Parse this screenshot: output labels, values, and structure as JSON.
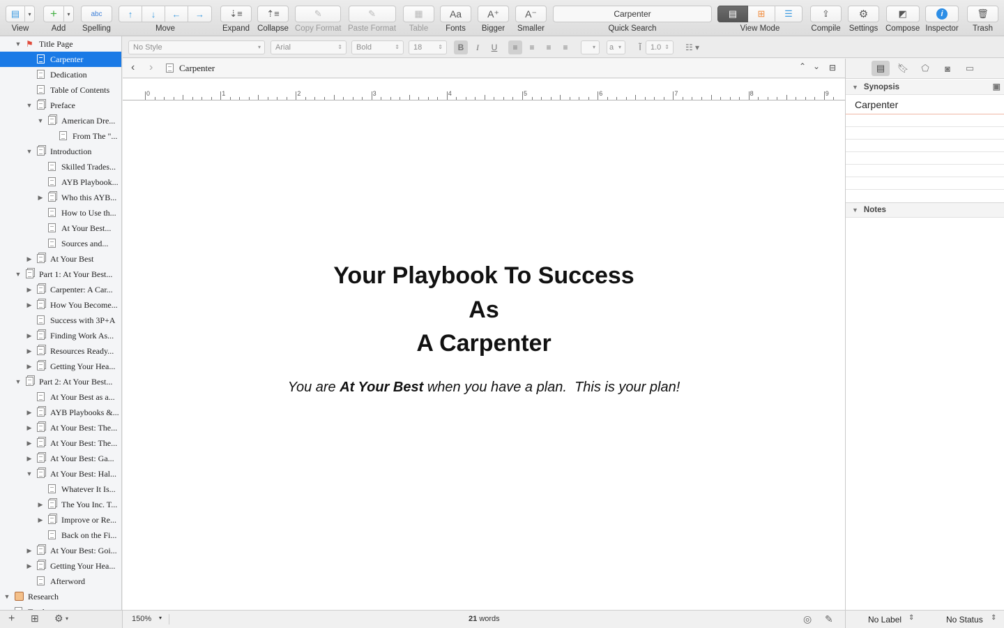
{
  "toolbar": {
    "view": "View",
    "add": "Add",
    "spelling": "Spelling",
    "move": "Move",
    "expand": "Expand",
    "collapse": "Collapse",
    "copy_format": "Copy Format",
    "paste_format": "Paste Format",
    "table": "Table",
    "fonts": "Fonts",
    "bigger": "Bigger",
    "smaller": "Smaller",
    "quick_search_value": "Carpenter",
    "quick_search": "Quick Search",
    "view_mode": "View Mode",
    "compile": "Compile",
    "settings": "Settings",
    "compose": "Compose",
    "inspector": "Inspector",
    "trash": "Trash",
    "spelling_icon_text": "abc",
    "fonts_icon_text": "Aa",
    "bigger_icon_text": "A⁺",
    "smaller_icon_text": "A⁻"
  },
  "binder": {
    "items": [
      {
        "label": "Title Page"
      },
      {
        "label": "Carpenter"
      },
      {
        "label": "Dedication"
      },
      {
        "label": "Table of Contents"
      },
      {
        "label": "Preface"
      },
      {
        "label": "American Dre..."
      },
      {
        "label": "From The \"..."
      },
      {
        "label": "Introduction"
      },
      {
        "label": "Skilled Trades..."
      },
      {
        "label": "AYB Playbook..."
      },
      {
        "label": "Who this AYB..."
      },
      {
        "label": "How to Use th..."
      },
      {
        "label": "At Your Best..."
      },
      {
        "label": "Sources and..."
      },
      {
        "label": "At Your Best"
      },
      {
        "label": "Part 1:  At Your Best..."
      },
      {
        "label": "Carpenter:  A Car..."
      },
      {
        "label": "How You Become..."
      },
      {
        "label": "Success with 3P+A"
      },
      {
        "label": "Finding Work As..."
      },
      {
        "label": "Resources Ready..."
      },
      {
        "label": "Getting Your Hea..."
      },
      {
        "label": "Part 2:  At Your Best..."
      },
      {
        "label": "At Your Best as a..."
      },
      {
        "label": "AYB Playbooks &..."
      },
      {
        "label": "At Your Best: The..."
      },
      {
        "label": "At Your Best: The..."
      },
      {
        "label": "At Your Best: Ga..."
      },
      {
        "label": "At Your Best: Hal..."
      },
      {
        "label": "Whatever It Is..."
      },
      {
        "label": "The You Inc. T..."
      },
      {
        "label": "Improve or Re..."
      },
      {
        "label": "Back on the Fi..."
      },
      {
        "label": "At Your Best: Goi..."
      },
      {
        "label": "Getting Your Hea..."
      },
      {
        "label": "Afterword"
      },
      {
        "label": "Research"
      },
      {
        "label": "Trash"
      }
    ]
  },
  "format": {
    "style": "No Style",
    "font": "Arial",
    "weight": "Bold",
    "size": "18",
    "bold": "B",
    "italic": "I",
    "underline": "U",
    "line_spacing": "1.0",
    "highlight": "a"
  },
  "editor": {
    "doc_title": "Carpenter",
    "ruler_marks": [
      "0",
      "1",
      "2",
      "3",
      "4",
      "5",
      "6",
      "7",
      "8",
      "9"
    ],
    "title_lines": [
      "Your Playbook To Success",
      "As",
      "A Carpenter"
    ],
    "subtitle_pre": "You are ",
    "subtitle_bold": "At Your Best",
    "subtitle_post": " when you have a plan.  This is your plan!",
    "zoom": "150%",
    "word_count": "21",
    "words_label": "words"
  },
  "inspector": {
    "synopsis_title": "Synopsis",
    "synopsis_text": "Carpenter",
    "notes_title": "Notes",
    "label_value": "No Label",
    "status_value": "No Status"
  }
}
